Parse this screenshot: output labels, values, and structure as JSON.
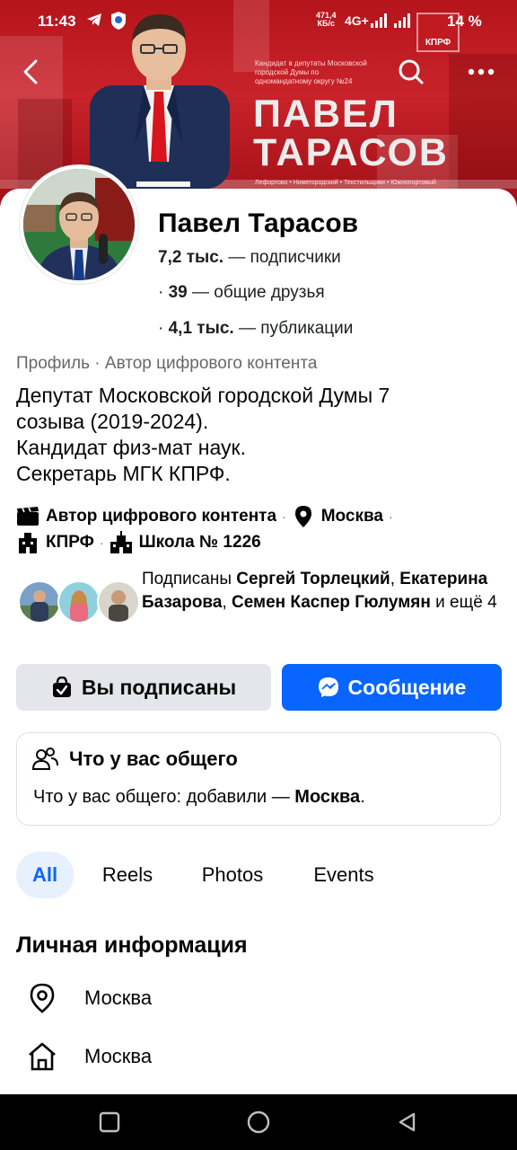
{
  "status_bar": {
    "time": "11:43",
    "net_speed_top": "471,4",
    "net_speed_bottom": "КБ/с",
    "network": "4G+",
    "battery": "14 %"
  },
  "cover": {
    "poster_small_text": "Кандидат в депутаты Московской городской Думы по одномандатному округу №24",
    "poster_name_line1": "ПАВЕЛ",
    "poster_name_line2": "ТАРАСОВ",
    "poster_districts": "Лефортово • Нижегородский • Текстильщики • Южнопортовый",
    "logo_text": "КПРФ"
  },
  "profile": {
    "name": "Павел Тарасов",
    "followers_value": "7,2 тыс.",
    "followers_label": " — подписчики",
    "friends_prefix": "· ",
    "friends_value": "39",
    "friends_label": " — общие друзья",
    "posts_prefix": "· ",
    "posts_value": "4,1 тыс.",
    "posts_label": " — публикации",
    "profile_type": "Профиль · Автор цифрового контента",
    "bio": [
      "Депутат Московской городской Думы 7",
      "созыва (2019-2024).",
      "Кандидат физ-мат наук.",
      "Секретарь МГК КПРФ."
    ],
    "info": {
      "category": "Автор цифрового контента",
      "city": "Москва",
      "org": "КПРФ",
      "school": "Школа № 1226",
      "separator": "·"
    },
    "mutual": {
      "prefix": "Подписаны ",
      "name1": "Сергей Торлецкий",
      "sep1": ", ",
      "name2": "Екатерина Базарова",
      "sep2": ", ",
      "name3": "Семен Каспер Гюлумян",
      "suffix": " и ещё 4"
    }
  },
  "actions": {
    "subscribed_label": "Вы подписаны",
    "message_label": "Сообщение"
  },
  "common": {
    "title": "Что у вас общего",
    "text_prefix": "Что у вас общего: добавили — ",
    "text_value": "Москва",
    "text_suffix": "."
  },
  "tabs": [
    {
      "label": "All",
      "active": true
    },
    {
      "label": "Reels",
      "active": false
    },
    {
      "label": "Photos",
      "active": false
    },
    {
      "label": "Events",
      "active": false
    }
  ],
  "personal_info": {
    "title": "Личная информация",
    "location": "Москва",
    "hometown": "Москва"
  },
  "colors": {
    "accent": "#0866ff",
    "cover_red": "#c9232a",
    "muted_text": "#65676b",
    "button_grey": "#e4e6eb",
    "tab_active_bg": "#e7f0fd"
  },
  "icons": {
    "back": "arrow-left-icon",
    "search": "search-icon",
    "more": "more-dots-icon",
    "category": "clapperboard-icon",
    "city": "location-pin-icon",
    "org": "building-icon",
    "school": "school-building-icon",
    "subscribed": "check-bag-icon",
    "message": "messenger-icon",
    "common": "people-icon",
    "location": "location-pin-outline-icon",
    "home": "home-outline-icon"
  }
}
